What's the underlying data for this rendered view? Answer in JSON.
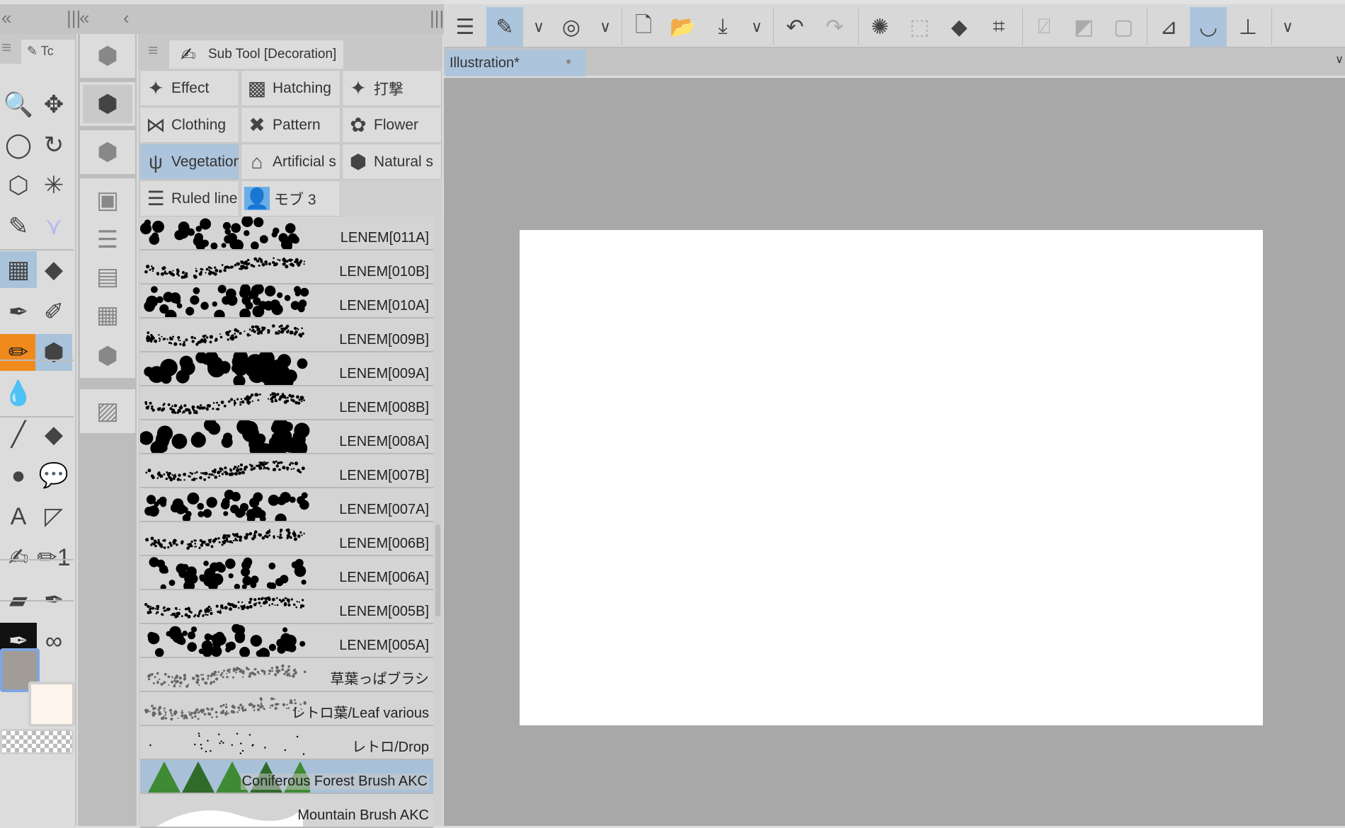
{
  "panel_header": {
    "collapse_left": "«",
    "collapse_all": "«",
    "collapse": "‹",
    "grip": "|||"
  },
  "tool_panel": {
    "tab_label": "Tc",
    "menu_icon": "≡",
    "tools": [
      {
        "name": "zoom-icon",
        "glyph": "🔍"
      },
      {
        "name": "move-icon",
        "glyph": "✥"
      },
      {
        "name": "lasso-icon",
        "glyph": "◯"
      },
      {
        "name": "rotate-icon",
        "glyph": "↻"
      },
      {
        "name": "object-select-icon",
        "glyph": "⬡"
      },
      {
        "name": "magic-wand-icon",
        "glyph": "✳"
      },
      {
        "name": "eyedropper-icon",
        "glyph": "✎"
      },
      {
        "name": "auto-action-icon",
        "glyph": "⋎"
      },
      {
        "name": "airbrush-icon",
        "glyph": "▦",
        "state": "selected"
      },
      {
        "name": "eraser-icon",
        "glyph": "◆"
      },
      {
        "name": "pen-icon",
        "glyph": "✒"
      },
      {
        "name": "pencil-icon",
        "glyph": "✐"
      },
      {
        "name": "brush-icon",
        "glyph": "✏",
        "state": "orange"
      },
      {
        "name": "decoration-icon",
        "glyph": "⬢",
        "state": "selected"
      },
      {
        "name": "blend-icon",
        "glyph": "💧"
      },
      {
        "name": "empty",
        "glyph": ""
      },
      {
        "name": "line-icon",
        "glyph": "╱"
      },
      {
        "name": "fill-icon",
        "glyph": "◆"
      },
      {
        "name": "gradient-icon",
        "glyph": "●"
      },
      {
        "name": "balloon-icon",
        "glyph": "💬"
      },
      {
        "name": "text-icon",
        "glyph": "A"
      },
      {
        "name": "frame-border-icon",
        "glyph": "◸"
      },
      {
        "name": "correct-line-icon",
        "glyph": "✍"
      },
      {
        "name": "pencil-1-icon",
        "glyph": "✏1"
      },
      {
        "name": "marker-icon",
        "glyph": "▰"
      },
      {
        "name": "fountain-pen-icon",
        "glyph": "✒"
      },
      {
        "name": "ink-pen-icon",
        "glyph": "✒",
        "state": "black"
      },
      {
        "name": "bubbles-icon",
        "glyph": "∞"
      }
    ],
    "main_color": "#a19c98",
    "sub_color": "#fdf4ec"
  },
  "category_panel": {
    "items": [
      "sub-tool-settings-icon",
      "decoration-category-icon",
      "sub-tool-target-icon",
      "square-icon",
      "layers-icon",
      "film-icon",
      "grid-icon",
      "object-layers-icon",
      "image-icon"
    ]
  },
  "sub_tool": {
    "menu_icon": "≡",
    "title": "Sub Tool [Decoration]",
    "groups": [
      {
        "label": "Effect",
        "icon": "✦"
      },
      {
        "label": "Hatching",
        "icon": "▩"
      },
      {
        "label": "打撃",
        "icon": "✦"
      },
      {
        "label": "Clothing",
        "icon": "⋈"
      },
      {
        "label": "Pattern",
        "icon": "✖"
      },
      {
        "label": "Flower",
        "icon": "✿"
      },
      {
        "label": "Vegetation",
        "icon": "ψ",
        "selected": true
      },
      {
        "label": "Artificial s",
        "icon": "⌂"
      },
      {
        "label": "Natural s",
        "icon": "⬢"
      },
      {
        "label": "Ruled line",
        "icon": "☰"
      },
      {
        "label": "モブ 3",
        "icon": "👤"
      }
    ],
    "brushes": [
      {
        "label": "LENEM[011A]",
        "style": "blob"
      },
      {
        "label": "LENEM[010B]",
        "style": "dots"
      },
      {
        "label": "LENEM[010A]",
        "style": "blob"
      },
      {
        "label": "LENEM[009B]",
        "style": "dots"
      },
      {
        "label": "LENEM[009A]",
        "style": "bigblob"
      },
      {
        "label": "LENEM[008B]",
        "style": "dots"
      },
      {
        "label": "LENEM[008A]",
        "style": "bigblob"
      },
      {
        "label": "LENEM[007B]",
        "style": "dots"
      },
      {
        "label": "LENEM[007A]",
        "style": "blob"
      },
      {
        "label": "LENEM[006B]",
        "style": "dots"
      },
      {
        "label": "LENEM[006A]",
        "style": "blob"
      },
      {
        "label": "LENEM[005B]",
        "style": "dots"
      },
      {
        "label": "LENEM[005A]",
        "style": "blob"
      },
      {
        "label": "草葉っぱブラシ",
        "style": "sketch"
      },
      {
        "label": "レトロ葉/Leaf various",
        "style": "sketch"
      },
      {
        "label": "レトロ/Drop",
        "style": "drop"
      },
      {
        "label": "Coniferous Forest Brush AKC",
        "style": "forest",
        "selected": true
      },
      {
        "label": "Mountain Brush AKC",
        "style": "mountain"
      }
    ]
  },
  "toolbar": {
    "items": [
      {
        "name": "menu-icon",
        "glyph": "☰"
      },
      {
        "name": "brush-tool-icon",
        "glyph": "✎",
        "selected": true
      },
      {
        "name": "chevron-down-icon",
        "glyph": "∨"
      },
      {
        "name": "spiral-icon",
        "glyph": "◎"
      },
      {
        "name": "chevron-down-icon",
        "glyph": "∨"
      },
      {
        "sep": true
      },
      {
        "name": "new-file-icon",
        "glyph": "🗋"
      },
      {
        "name": "open-folder-icon",
        "glyph": "📂"
      },
      {
        "name": "save-icon",
        "glyph": "⤓"
      },
      {
        "name": "chevron-down-icon",
        "glyph": "∨"
      },
      {
        "sep": true
      },
      {
        "name": "undo-icon",
        "glyph": "↶"
      },
      {
        "name": "redo-icon",
        "glyph": "↷",
        "dim": true
      },
      {
        "sep": true
      },
      {
        "name": "loading-icon",
        "glyph": "✺"
      },
      {
        "name": "select-dim-icon",
        "glyph": "⬚",
        "dim": true
      },
      {
        "name": "fill-bucket-icon",
        "glyph": "◆"
      },
      {
        "name": "transform-icon",
        "glyph": "⌗"
      },
      {
        "sep": true
      },
      {
        "name": "clear-selection-icon",
        "glyph": "⍁",
        "dim": true
      },
      {
        "name": "invert-selection-icon",
        "glyph": "◩",
        "dim": true
      },
      {
        "name": "selection-border-icon",
        "glyph": "▢",
        "dim": true
      },
      {
        "sep": true
      },
      {
        "name": "ruler-snap-icon",
        "glyph": "⊿"
      },
      {
        "name": "special-ruler-snap-icon",
        "glyph": "◡",
        "selected": true
      },
      {
        "name": "grid-snap-icon",
        "glyph": "⊥"
      },
      {
        "sep": true
      },
      {
        "name": "chevron-down-icon",
        "glyph": "∨"
      }
    ]
  },
  "document": {
    "tab_title": "Illustration*",
    "modified_dot": "●",
    "menu_chevron": "∨"
  }
}
